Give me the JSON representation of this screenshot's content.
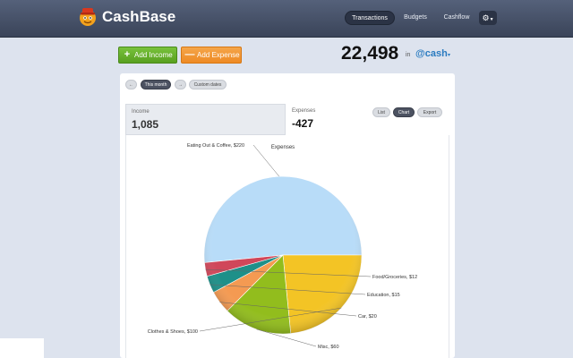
{
  "app": {
    "name": "CashBase"
  },
  "nav": {
    "transactions": "Transactions",
    "budgets": "Budgets",
    "cashflow": "Cashflow",
    "settings_icon": "gear-icon"
  },
  "actions": {
    "add_income": "Add Income",
    "add_expense": "Add Expense",
    "income_sign": "+",
    "expense_sign": "—"
  },
  "balance": {
    "amount": "22,498",
    "in_label": "in",
    "account": "@cash",
    "caret": "▾"
  },
  "period": {
    "prev": "←",
    "current": "This month",
    "next": "→",
    "custom": "Custom dates"
  },
  "summary": {
    "income_label": "Income",
    "income_value": "1,085",
    "expense_label": "Expenses",
    "expense_value": "-427"
  },
  "views": {
    "list": "List",
    "chart": "Chart",
    "export": "Export"
  },
  "colors": {
    "slices": [
      "#b8dcf8",
      "#f3c425",
      "#92bd1d",
      "#f49a52",
      "#1e9089",
      "#d0475a"
    ],
    "income_button": "#68b22e",
    "expense_button": "#f09632",
    "account": "#2a7bc0"
  },
  "chart_data": {
    "type": "pie",
    "title": "Expenses",
    "categories": [
      "Eating Out & Coffee",
      "Clothes & Shoes",
      "Misc.",
      "Car",
      "Education",
      "Food/Groceries"
    ],
    "values": [
      220,
      100,
      60,
      20,
      15,
      12
    ],
    "labels": [
      "Eating Out & Coffee, $220",
      "Clothes & Shoes, $100",
      "Misc, $60",
      "Car, $20",
      "Education, $15",
      "Food/Groceries, $12"
    ]
  }
}
